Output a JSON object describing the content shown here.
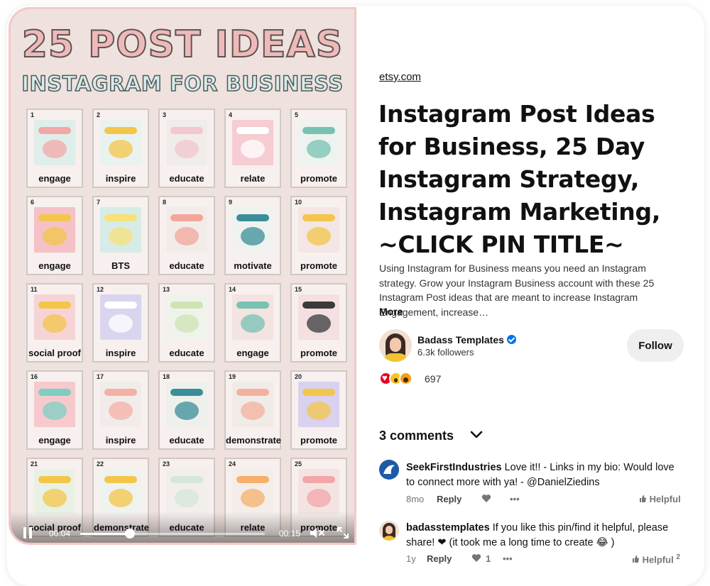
{
  "poster": {
    "title": "25 POST IDEAS",
    "subtitle": "INSTAGRAM FOR BUSINESS",
    "tiles": [
      {
        "num": "1",
        "label": "engage",
        "bg": "#dfeeea",
        "accent": "#f4a7a7"
      },
      {
        "num": "2",
        "label": "inspire",
        "bg": "#eaf2ef",
        "accent": "#f3c64a"
      },
      {
        "num": "3",
        "label": "educate",
        "bg": "#f0ecea",
        "accent": "#f2c7cd"
      },
      {
        "num": "4",
        "label": "relate",
        "bg": "#f5cdd2",
        "accent": "#ffffff"
      },
      {
        "num": "5",
        "label": "promote",
        "bg": "#eef3ef",
        "accent": "#77c2b3"
      },
      {
        "num": "6",
        "label": "engage",
        "bg": "#f4c2c6",
        "accent": "#f3c64a"
      },
      {
        "num": "7",
        "label": "BTS",
        "bg": "#d7ece7",
        "accent": "#f7e27a"
      },
      {
        "num": "8",
        "label": "educate",
        "bg": "#f2ece9",
        "accent": "#f2a59a"
      },
      {
        "num": "9",
        "label": "motivate",
        "bg": "#eff2ee",
        "accent": "#3b8d99"
      },
      {
        "num": "10",
        "label": "promote",
        "bg": "#f3e6e4",
        "accent": "#f3c64a"
      },
      {
        "num": "11",
        "label": "social proof",
        "bg": "#f6d4d6",
        "accent": "#f3c64a"
      },
      {
        "num": "12",
        "label": "inspire",
        "bg": "#d9d5ef",
        "accent": "#ffffff"
      },
      {
        "num": "13",
        "label": "educate",
        "bg": "#f0f3ec",
        "accent": "#cfe3b4"
      },
      {
        "num": "14",
        "label": "engage",
        "bg": "#f3e3e1",
        "accent": "#77c2b3"
      },
      {
        "num": "15",
        "label": "promote",
        "bg": "#f4dfe1",
        "accent": "#3a3a3a"
      },
      {
        "num": "16",
        "label": "engage",
        "bg": "#f6c9cd",
        "accent": "#7ccfc3"
      },
      {
        "num": "17",
        "label": "inspire",
        "bg": "#f1ece9",
        "accent": "#f4b0a5"
      },
      {
        "num": "18",
        "label": "educate",
        "bg": "#eef0ec",
        "accent": "#3b8d99"
      },
      {
        "num": "19",
        "label": "demonstrate",
        "bg": "#f1ebe8",
        "accent": "#f3b29e"
      },
      {
        "num": "20",
        "label": "promote",
        "bg": "#d9d1ee",
        "accent": "#f3c64a"
      },
      {
        "num": "21",
        "label": "social proof",
        "bg": "#e9f1e4",
        "accent": "#f3c64a"
      },
      {
        "num": "22",
        "label": "demonstrate",
        "bg": "#eef3ef",
        "accent": "#f3c64a"
      },
      {
        "num": "23",
        "label": "educate",
        "bg": "#f2eeeb",
        "accent": "#d6e7d9"
      },
      {
        "num": "24",
        "label": "relate",
        "bg": "#f4eeea",
        "accent": "#f6b06a"
      },
      {
        "num": "25",
        "label": "promote",
        "bg": "#f4e4e1",
        "accent": "#f3a5a9"
      }
    ]
  },
  "video": {
    "current_time": "00:04",
    "duration": "00:15",
    "progress": 0.27
  },
  "pin": {
    "source": "etsy.com",
    "title": "Instagram Post Ideas for Business, 25 Day Instagram Strategy, Instagram Marketing, ~CLICK PIN TITLE~",
    "description": "Using Instagram for Business means you need an Instagram strategy. Grow your Instagram Business account with these 25 Instagram Post ideas that are meant to increase Instagram Engagement, increase…",
    "more_label": "More"
  },
  "creator": {
    "name": "Badass Templates",
    "followers": "6.3k followers",
    "follow_label": "Follow"
  },
  "reactions": {
    "count": "697"
  },
  "comments": {
    "header": "3 comments",
    "items": [
      {
        "user": "SeekFirstIndustries",
        "text": "Love it!! - Links in my bio: Would love to connect more with ya! - @DanielZiedins",
        "age": "8mo",
        "reply_label": "Reply",
        "like_count": "",
        "helpful_label": "Helpful",
        "helpful_count": ""
      },
      {
        "user": "badasstemplates",
        "text": "If you like this pin/find it helpful, please share! ❤ (it took me a long time to create 😂 )",
        "age": "1y",
        "reply_label": "Reply",
        "like_count": "1",
        "helpful_label": "Helpful",
        "helpful_count": "2"
      }
    ]
  },
  "colors": {
    "brand_red": "#e60023",
    "verified_blue": "#0074e8",
    "button_gray": "#efefef"
  }
}
